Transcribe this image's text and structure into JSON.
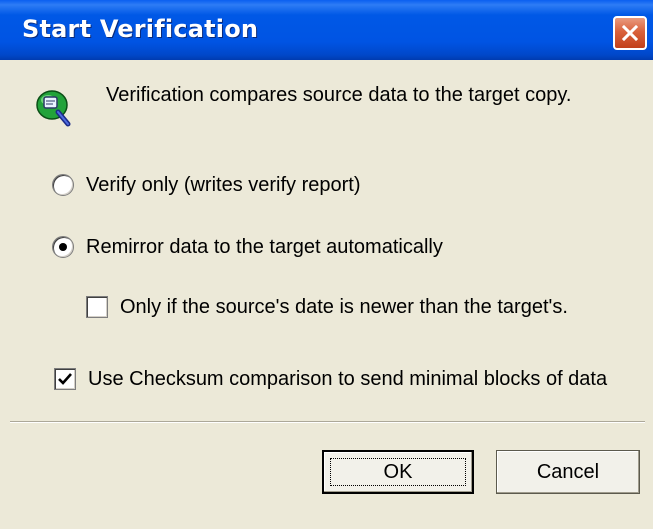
{
  "dialog": {
    "title": "Start Verification",
    "description": "Verification compares source data to the target copy."
  },
  "options": {
    "verify_only": {
      "label": "Verify only (writes verify report)",
      "selected": false
    },
    "remirror": {
      "label": "Remirror data to the target automatically",
      "selected": true
    },
    "only_if_newer": {
      "label": "Only if the source's date is newer than the target's.",
      "checked": false
    },
    "use_checksum": {
      "label": "Use Checksum comparison to send minimal blocks of data",
      "checked": true
    }
  },
  "buttons": {
    "ok": "OK",
    "cancel": "Cancel"
  },
  "colors": {
    "titlebar": "#0054e3",
    "dialog_bg": "#ece9d8",
    "close_button": "#d9623c"
  },
  "icons": {
    "title_close": "close-icon",
    "dialog_icon": "verify-icon"
  }
}
